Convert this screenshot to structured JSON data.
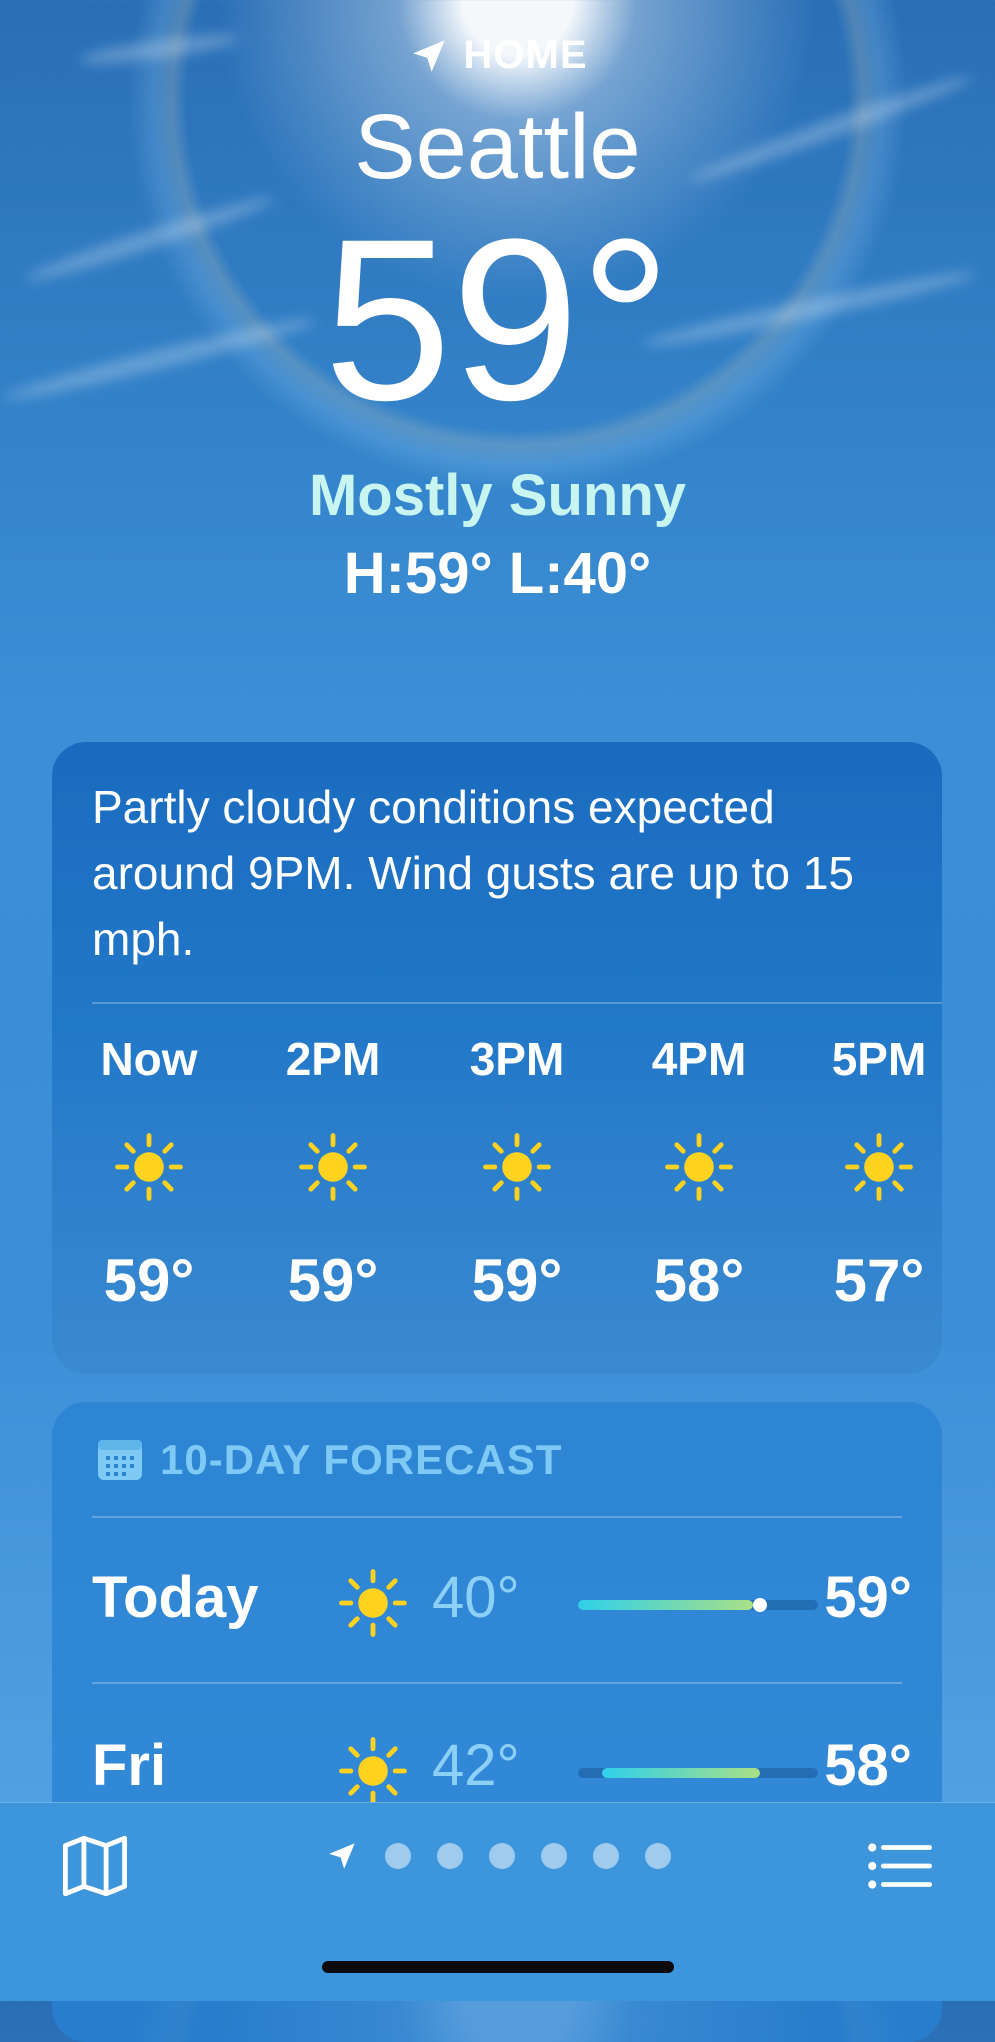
{
  "location": {
    "label": "HOME",
    "city": "Seattle",
    "temperature": "59°",
    "condition": "Mostly Sunny",
    "high_low": "H:59°  L:40°"
  },
  "hourly": {
    "summary": "Partly cloudy conditions expected around 9PM. Wind gusts are up to 15 mph.",
    "hours": [
      {
        "time": "Now",
        "icon": "sun-icon",
        "temp": "59°"
      },
      {
        "time": "2PM",
        "icon": "sun-icon",
        "temp": "59°"
      },
      {
        "time": "3PM",
        "icon": "sun-icon",
        "temp": "59°"
      },
      {
        "time": "4PM",
        "icon": "sun-icon",
        "temp": "58°"
      },
      {
        "time": "5PM",
        "icon": "sun-icon",
        "temp": "57°"
      }
    ]
  },
  "forecast": {
    "title": "10-DAY FORECAST",
    "icon": "calendar-icon",
    "days": [
      {
        "day": "Today",
        "icon": "sun-icon",
        "low": "40°",
        "high": "59°",
        "range_start": 0.0,
        "range_end": 0.73,
        "current_position": 0.76
      },
      {
        "day": "Fri",
        "icon": "sun-icon",
        "low": "42°",
        "high": "58°",
        "range_start": 0.1,
        "range_end": 0.76
      }
    ]
  },
  "bottom_bar": {
    "left_icon": "map-icon",
    "right_icon": "list-icon",
    "page_count": 6,
    "current_page": 0
  },
  "colors": {
    "sun": "#FFD21F",
    "condition_text": "#C9F5F1",
    "low_temp_text": "#8DD0F5",
    "section_header": "#7FCAF5"
  }
}
